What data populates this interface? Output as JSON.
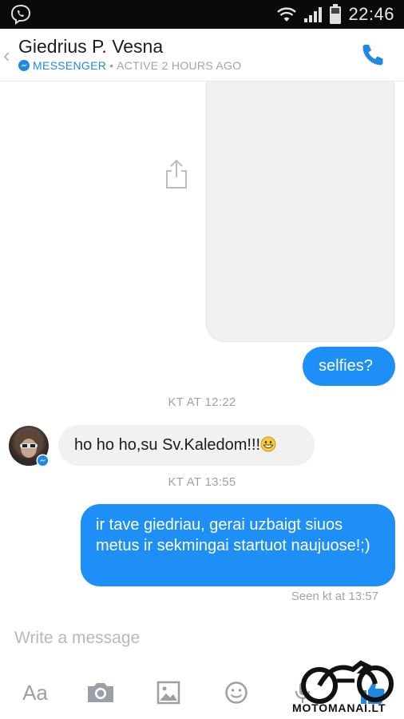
{
  "status_bar": {
    "time": "22:46",
    "icons": [
      "viber-icon",
      "wifi-icon",
      "signal-icon",
      "battery-icon"
    ]
  },
  "header": {
    "contact_name": "Giedrius P. Vesna",
    "platform": "MESSENGER",
    "separator": "•",
    "activity": "ACTIVE 2 HOURS AGO",
    "icons": [
      "back-chevron-icon",
      "messenger-icon",
      "phone-icon"
    ]
  },
  "conversation": {
    "messages": [
      {
        "type": "attachment",
        "from": "me",
        "icon": "share-icon"
      },
      {
        "type": "text",
        "from": "me",
        "text": "selfies?"
      },
      {
        "type": "timestamp",
        "text": "KT AT 12:22"
      },
      {
        "type": "text",
        "from": "contact",
        "text": "ho ho ho,su Sv.Kaledom!!!",
        "emoji": "grinning-smiley"
      },
      {
        "type": "timestamp",
        "text": "KT AT 13:55"
      },
      {
        "type": "text",
        "from": "me",
        "text": "ir tave giedriau, gerai uzbaigt siuos metus ir sekmingai startuot naujuose!;)"
      }
    ],
    "seen_receipt": "Seen kt at 13:57"
  },
  "composer": {
    "placeholder": "Write a message",
    "toolbar": {
      "text_format_label": "Aa",
      "icons": [
        "camera-icon",
        "image-icon",
        "emoji-icon",
        "microphone-icon",
        "like-icon"
      ]
    }
  },
  "watermark": {
    "text": "MOTOMANAI.LT"
  },
  "colors": {
    "accent": "#1e8ff6",
    "incoming_bubble": "#f0f1f3",
    "status_bar": "#0a0a0a",
    "meta_text": "#9ea2a7"
  }
}
